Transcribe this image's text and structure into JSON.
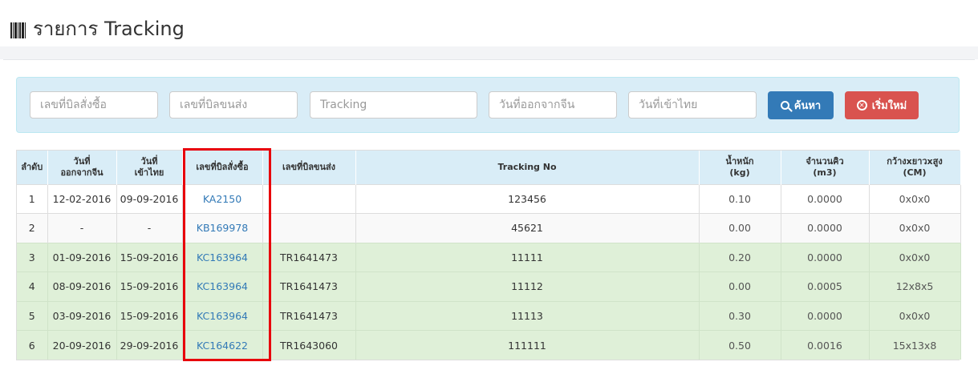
{
  "page": {
    "title": "รายการ Tracking",
    "icon": "barcode-icon"
  },
  "search": {
    "order_no_placeholder": "เลขที่บิลสั่งซื้อ",
    "shipping_no_placeholder": "เลขที่บิลขนส่ง",
    "tracking_placeholder": "Tracking",
    "china_date_placeholder": "วันที่ออกจากจีน",
    "thai_date_placeholder": "วันที่เข้าไทย",
    "search_button": "ค้นหา",
    "reset_button": "เริ่มใหม่",
    "search_color": "#337ab7",
    "reset_color": "#d9534f"
  },
  "table": {
    "headers": {
      "no": "ลำดับ",
      "china_date_1": "วันที่",
      "china_date_2": "ออกจากจีน",
      "thai_date_1": "วันที่",
      "thai_date_2": "เข้าไทย",
      "order_no": "เลขที่บิลสั่งซื้อ",
      "shipping_no": "เลขที่บิลขนส่ง",
      "tracking_no": "Tracking No",
      "weight_1": "น้ำหนัก",
      "weight_2": "(kg)",
      "volume_1": "จำนวนคิว",
      "volume_2": "(m3)",
      "dims_1": "กว้างxยาวxสูง",
      "dims_2": "(CM)"
    },
    "rows": [
      {
        "no": "1",
        "china_date": "12-02-2016",
        "thai_date": "09-09-2016",
        "order_no": "KA2150",
        "shipping_no": "",
        "tracking_no": "123456",
        "weight": "0.10",
        "volume": "0.0000",
        "dims": "0x0x0"
      },
      {
        "no": "2",
        "china_date": "-",
        "thai_date": "-",
        "order_no": "KB169978",
        "shipping_no": "",
        "tracking_no": "45621",
        "weight": "0.00",
        "volume": "0.0000",
        "dims": "0x0x0"
      },
      {
        "no": "3",
        "china_date": "01-09-2016",
        "thai_date": "15-09-2016",
        "order_no": "KC163964",
        "shipping_no": "TR1641473",
        "tracking_no": "11111",
        "weight": "0.20",
        "volume": "0.0000",
        "dims": "0x0x0"
      },
      {
        "no": "4",
        "china_date": "08-09-2016",
        "thai_date": "15-09-2016",
        "order_no": "KC163964",
        "shipping_no": "TR1641473",
        "tracking_no": "11112",
        "weight": "0.00",
        "volume": "0.0005",
        "dims": "12x8x5"
      },
      {
        "no": "5",
        "china_date": "03-09-2016",
        "thai_date": "15-09-2016",
        "order_no": "KC163964",
        "shipping_no": "TR1641473",
        "tracking_no": "11113",
        "weight": "0.30",
        "volume": "0.0000",
        "dims": "0x0x0"
      },
      {
        "no": "6",
        "china_date": "20-09-2016",
        "thai_date": "29-09-2016",
        "order_no": "KC164622",
        "shipping_no": "TR1643060",
        "tracking_no": "111111",
        "weight": "0.50",
        "volume": "0.0016",
        "dims": "15x13x8"
      }
    ],
    "highlight_color": "#e8000b"
  }
}
